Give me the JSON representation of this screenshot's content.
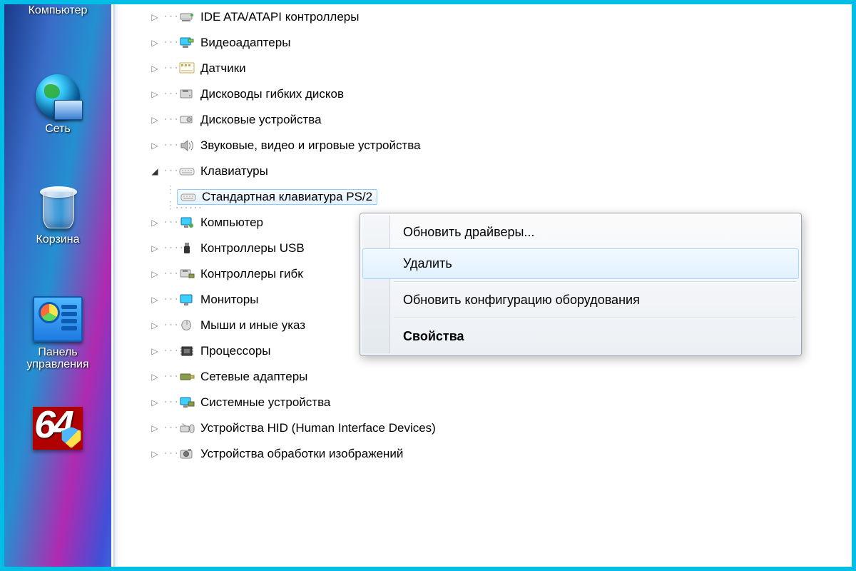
{
  "desktop": {
    "computer": "Компьютер",
    "network": "Сеть",
    "recycle": "Корзина",
    "cpanel_l1": "Панель",
    "cpanel_l2": "управления",
    "aida": "64"
  },
  "tree": {
    "ide": "IDE ATA/ATAPI контроллеры",
    "video": "Видеоадаптеры",
    "sensors": "Датчики",
    "floppy": "Дисководы гибких дисков",
    "disks": "Дисковые устройства",
    "sound": "Звуковые, видео и игровые устройства",
    "keyboards": "Клавиатуры",
    "kb_ps2": "Стандартная клавиатура PS/2",
    "computer": "Компьютер",
    "usb": "Контроллеры USB",
    "floppyctl": "Контроллеры гибк",
    "monitors": "Мониторы",
    "mice": "Мыши и иные указ",
    "cpu": "Процессоры",
    "net": "Сетевые адаптеры",
    "system": "Системные устройства",
    "hid": "Устройства HID (Human Interface Devices)",
    "imaging": "Устройства обработки изображений"
  },
  "menu": {
    "update": "Обновить драйверы...",
    "delete": "Удалить",
    "rescan": "Обновить конфигурацию оборудования",
    "props": "Свойства"
  }
}
